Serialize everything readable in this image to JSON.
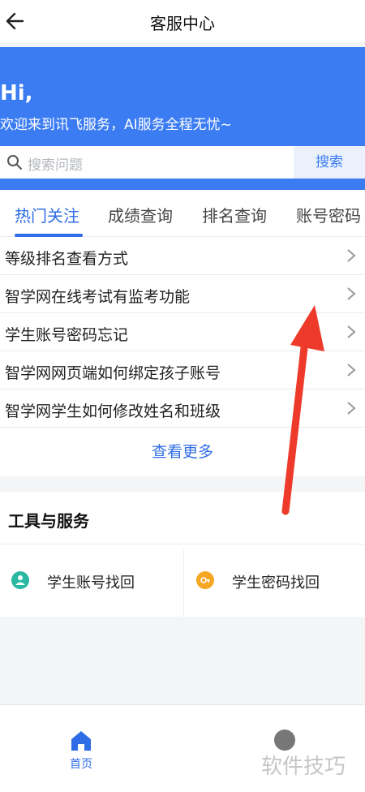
{
  "header": {
    "title": "客服中心"
  },
  "banner": {
    "greeting": "Hi,",
    "welcome": "欢迎来到讯飞服务，AI服务全程无忧~"
  },
  "search": {
    "placeholder": "搜索问题",
    "button_label": "搜索"
  },
  "tabs": [
    {
      "label": "热门关注",
      "active": true
    },
    {
      "label": "成绩查询",
      "active": false
    },
    {
      "label": "排名查询",
      "active": false
    },
    {
      "label": "账号密码",
      "active": false
    }
  ],
  "faq": {
    "items": [
      {
        "label": "等级排名查看方式"
      },
      {
        "label": "智学网在线考试有监考功能"
      },
      {
        "label": "学生账号密码忘记"
      },
      {
        "label": "智学网网页端如何绑定孩子账号"
      },
      {
        "label": "智学网学生如何修改姓名和班级"
      }
    ],
    "more_label": "查看更多"
  },
  "tools": {
    "title": "工具与服务",
    "items": [
      {
        "label": "学生账号找回",
        "icon": "person-icon",
        "color": "#2bb8a3"
      },
      {
        "label": "学生密码找回",
        "icon": "key-icon",
        "color": "#f5a623"
      }
    ]
  },
  "bottom_nav": {
    "home_label": "首页"
  },
  "watermark": "软件技巧",
  "colors": {
    "accent": "#2f6de6",
    "banner": "#3b7cf3",
    "annotation_arrow": "#ee3a2a"
  }
}
